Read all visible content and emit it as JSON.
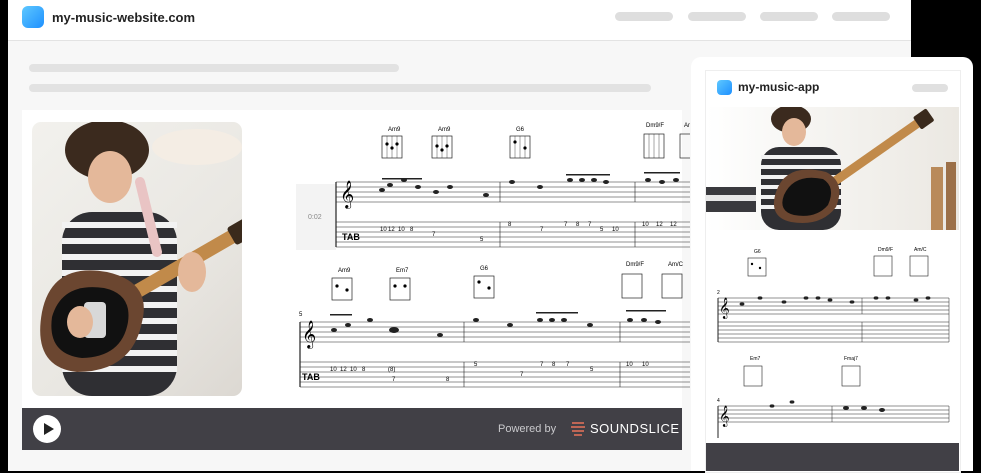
{
  "site": {
    "title": "my-music-website.com"
  },
  "player": {
    "powered_by": "Powered by",
    "brand": "SOUNDSLICE",
    "time": "0:02"
  },
  "score": {
    "row1_chords": [
      "Am9",
      "Am9",
      "G6",
      "Dm9/F",
      "Am"
    ],
    "row2_chords": [
      "Am9",
      "Em7",
      "G6",
      "Dm9/F",
      "Am/C"
    ],
    "row2_measure": "5",
    "row1_tab": [
      "10",
      "12",
      "10",
      "8",
      "7",
      "8",
      "5",
      "7",
      "7",
      "8",
      "7",
      "5",
      "10",
      "10",
      "12",
      "12"
    ],
    "row2_tab": [
      "10",
      "12",
      "10",
      "8",
      "(8)",
      "7",
      "8",
      "5",
      "7",
      "7",
      "8",
      "7",
      "5",
      "10",
      "10"
    ]
  },
  "mobile": {
    "title": "my-music-app",
    "row1_chords": [
      "G6",
      "Dm9/F",
      "Am/C"
    ],
    "row1_measure": "2",
    "row2_chords": [
      "Em7",
      "Fmaj7"
    ],
    "row2_measure": "4"
  },
  "colors": {
    "player_bg": "#414046",
    "app_icon": "#1e90ff"
  },
  "icons": {
    "play": "play-icon",
    "brand": "soundslice-logo-icon"
  }
}
